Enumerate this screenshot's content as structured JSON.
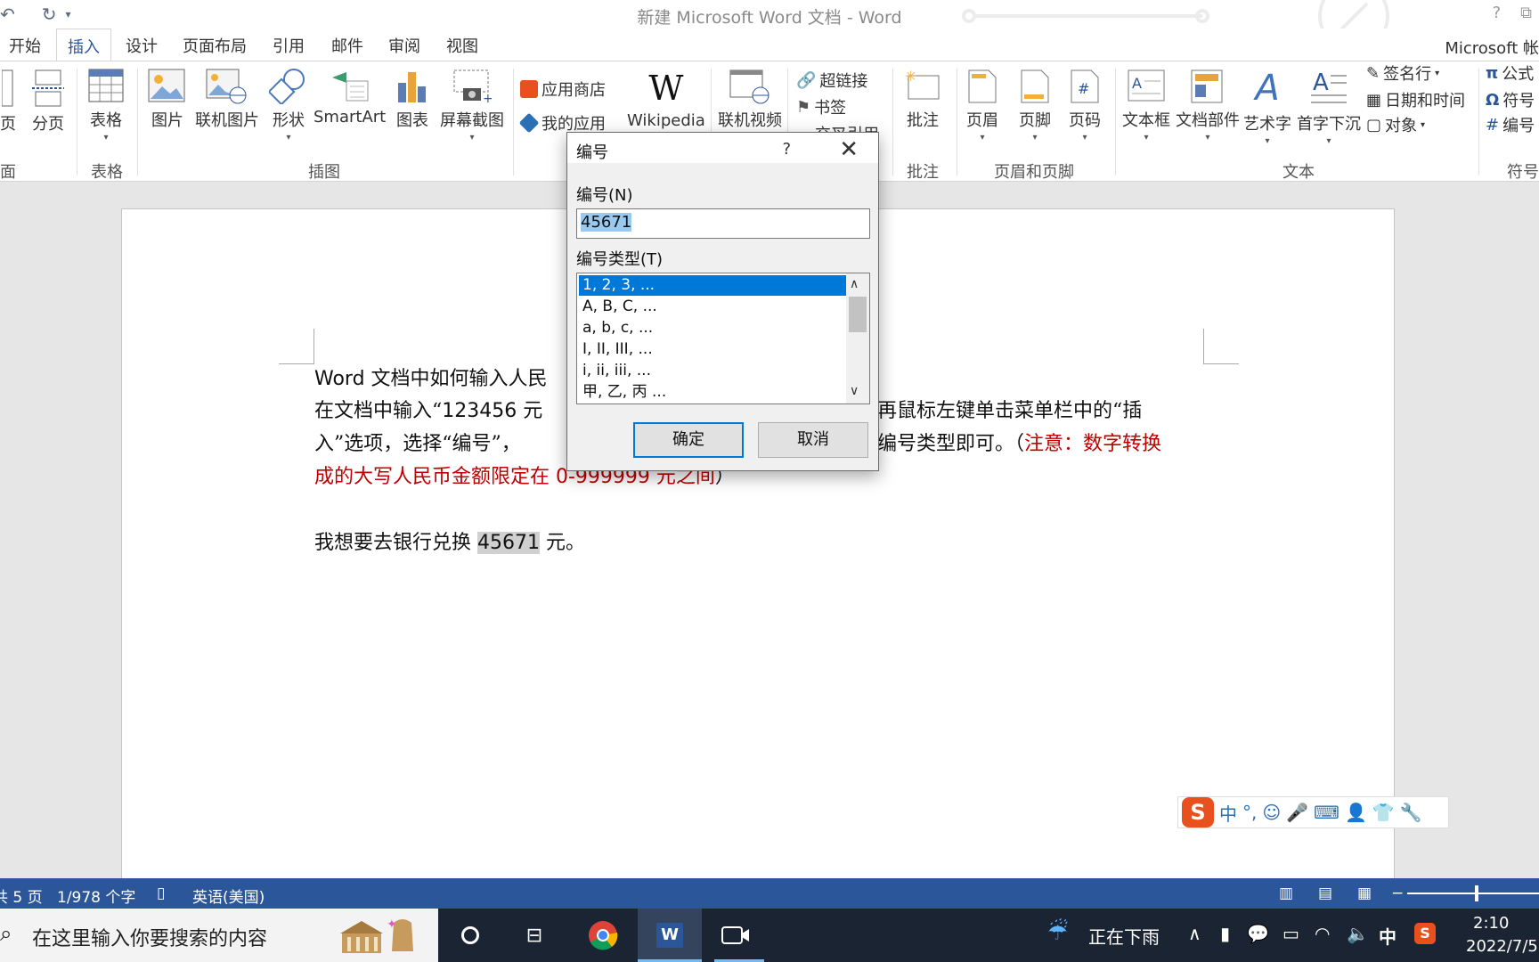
{
  "window": {
    "title": "新建 Microsoft Word 文档 - Word",
    "account": "Microsoft 帐",
    "help_label": "?"
  },
  "tabs": [
    {
      "label": "开始"
    },
    {
      "label": "插入"
    },
    {
      "label": "设计"
    },
    {
      "label": "页面布局"
    },
    {
      "label": "引用"
    },
    {
      "label": "邮件"
    },
    {
      "label": "审阅"
    },
    {
      "label": "视图"
    }
  ],
  "ribbon": {
    "pages_partial": "页",
    "page_break": "分页",
    "table": "表格",
    "picture": "图片",
    "online_picture": "联机图片",
    "shapes": "形状",
    "smartart": "SmartArt",
    "chart": "图表",
    "screenshot": "屏幕截图",
    "store": "应用商店",
    "my_apps": "我的应用",
    "wikipedia": "Wikipedia",
    "online_video": "联机视频",
    "hyperlink": "超链接",
    "bookmark": "书签",
    "cross_ref": "交叉引用",
    "comment": "批注",
    "header": "页眉",
    "footer": "页脚",
    "page_number": "页码",
    "textbox": "文本框",
    "quick_parts": "文档部件",
    "wordart": "艺术字",
    "dropcap": "首字下沉",
    "signature": "签名行",
    "datetime": "日期和时间",
    "object": "对象",
    "equation": "公式",
    "symbol": "符号",
    "numbering": "编号",
    "groups": {
      "pages": "面",
      "tables": "表格",
      "illustrations": "插图",
      "comments": "批注",
      "header_footer": "页眉和页脚",
      "text": "文本",
      "symbols": "符号"
    }
  },
  "document": {
    "line1_prefix": "Word",
    "line1_rest": " 文档中如何输入人民",
    "line2_a": "在文档中输入“",
    "line2_num": "123456",
    "line2_b": " 元",
    "line2_c": "再鼠标左键单击菜单栏中的“插",
    "line3_a": "入”选项，选择“编号”，",
    "line3_b": "编号类型即可。（",
    "line3_red": "注意：数字转换",
    "line4_red_a": "成的大写人民币金额限定在 ",
    "line4_red_num": "0-999999",
    "line4_red_b": " 元之间",
    "line4_end": "）",
    "line5_a": "我想要去银行兑换 ",
    "line5_num": "45671",
    "line5_b": " 元。"
  },
  "dialog": {
    "title": "编号",
    "help": "?",
    "number_label": "编号(N)",
    "number_value": "45671",
    "type_label": "编号类型(T)",
    "types": [
      "1, 2, 3, ...",
      "A, B, C, ...",
      "a, b, c, ...",
      "I, II, III, ...",
      "i, ii, iii, ...",
      "甲, 乙, 丙 ..."
    ],
    "selected_type": "1, 2, 3, ...",
    "ok": "确定",
    "cancel": "取消"
  },
  "statusbar": {
    "pages": "共 5 页",
    "words": "1/978 个字",
    "language": "英语(美国)"
  },
  "ime": {
    "logo": "S",
    "mode": "中",
    "punct": "°,"
  },
  "taskbar": {
    "search_placeholder": "在这里输入你要搜索的内容",
    "weather": "正在下雨",
    "ime_indicator": "中",
    "time": "2:10",
    "date": "2022/7/5"
  },
  "colors": {
    "accent": "#2b579a",
    "selection": "#0078d7",
    "red_note": "#c00000",
    "taskbar": "#1a2433"
  }
}
